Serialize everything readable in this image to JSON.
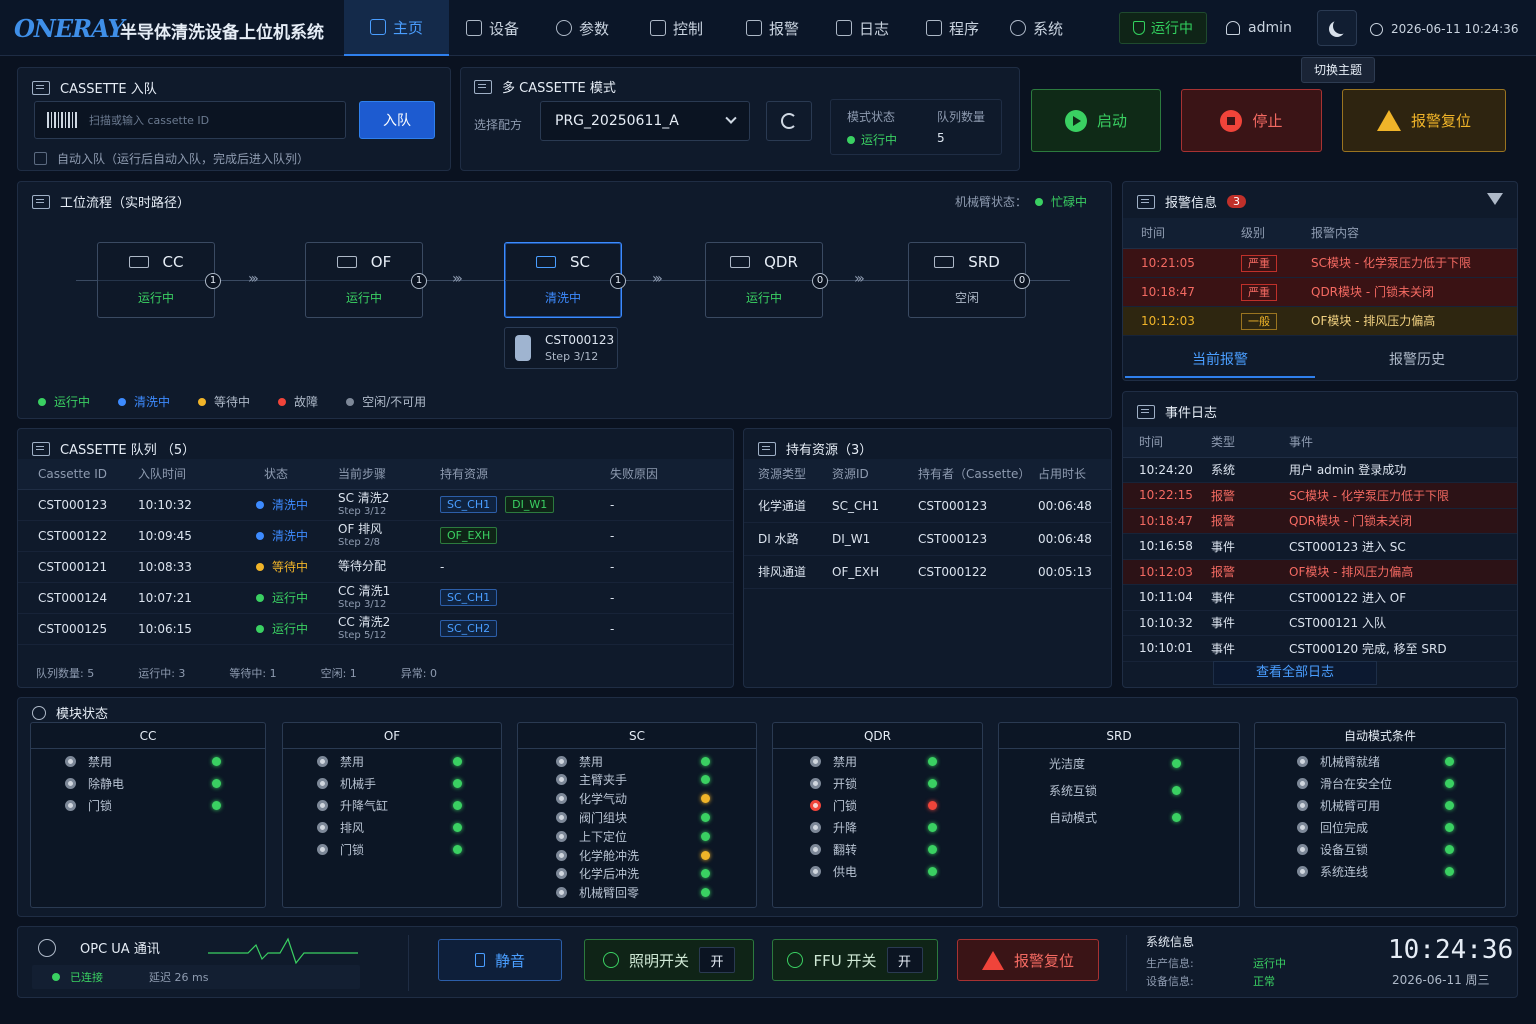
{
  "header": {
    "logo": "ONERAY",
    "title": "半导体清洗设备上位机系统",
    "nav": [
      {
        "label": "主页",
        "icon": "home-icon"
      },
      {
        "label": "设备",
        "icon": "device-icon"
      },
      {
        "label": "参数",
        "icon": "gear-icon"
      },
      {
        "label": "控制",
        "icon": "control-icon"
      },
      {
        "label": "报警",
        "icon": "warning-icon"
      },
      {
        "label": "日志",
        "icon": "log-icon"
      },
      {
        "label": "程序",
        "icon": "program-icon"
      },
      {
        "label": "系统",
        "icon": "system-icon"
      }
    ],
    "run_status": "运行中",
    "user": "admin",
    "theme_tooltip": "切换主题",
    "datetime": "2026-06-11  10:24:36"
  },
  "cassette_entry": {
    "title": "CASSETTE 入队",
    "placeholder": "扫描或输入 cassette ID",
    "enqueue": "入队",
    "auto_label": "自动入队（运行后自动入队，完成后进入队列）"
  },
  "multi": {
    "title": "多 CASSETTE 模式",
    "recipe_label": "选择配方",
    "recipe": "PRG_20250611_A",
    "mode_status_label": "模式状态",
    "mode_status": "运行中",
    "queue_count_label": "队列数量",
    "queue_count": "5",
    "start": "启动",
    "stop": "停止",
    "alarm_reset": "报警复位"
  },
  "flow": {
    "title": "工位流程（实时路径）",
    "arm_label": "机械臂状态：",
    "arm_status": "忙碌中",
    "nodes": [
      {
        "name": "CC",
        "status": "运行中",
        "count": "1"
      },
      {
        "name": "OF",
        "status": "运行中",
        "count": "1"
      },
      {
        "name": "SC",
        "status": "清洗中",
        "count": "1"
      },
      {
        "name": "QDR",
        "status": "运行中",
        "count": "0"
      },
      {
        "name": "SRD",
        "status": "空闲",
        "count": "0"
      }
    ],
    "sc_cassette": "CST000123",
    "sc_step": "Step 3/12",
    "legend": [
      "运行中",
      "清洗中",
      "等待中",
      "故障",
      "空闲/不可用"
    ]
  },
  "alarms": {
    "title": "报警信息",
    "count": "3",
    "headers": [
      "时间",
      "级别",
      "报警内容"
    ],
    "rows": [
      {
        "time": "10:21:05",
        "level": "严重",
        "content": "SC模块 - 化学泵压力低于下限"
      },
      {
        "time": "10:18:47",
        "level": "严重",
        "content": "QDR模块 - 门锁未关闭"
      },
      {
        "time": "10:12:03",
        "level": "一般",
        "content": "OF模块 - 排风压力偏高"
      }
    ],
    "tab_current": "当前报警",
    "tab_history": "报警历史"
  },
  "queue": {
    "title": "CASSETTE 队列 （5）",
    "headers": [
      "Cassette ID",
      "入队时间",
      "状态",
      "当前步骤",
      "持有资源",
      "失败原因"
    ],
    "rows": [
      {
        "id": "CST000123",
        "time": "10:10:32",
        "status": "清洗中",
        "step": "SC 清洗2",
        "step_sub": "Step 3/12",
        "res": [
          "SC_CH1",
          "DI_W1"
        ],
        "fail": "-"
      },
      {
        "id": "CST000122",
        "time": "10:09:45",
        "status": "清洗中",
        "step": "OF 排风",
        "step_sub": "Step 2/8",
        "res": [
          "OF_EXH"
        ],
        "fail": "-"
      },
      {
        "id": "CST000121",
        "time": "10:08:33",
        "status": "等待中",
        "step": "等待分配",
        "step_sub": "",
        "res": [],
        "res_text": "-",
        "fail": "-"
      },
      {
        "id": "CST000124",
        "time": "10:07:21",
        "status": "运行中",
        "step": "CC 清洗1",
        "step_sub": "Step 3/12",
        "res": [
          "SC_CH1"
        ],
        "fail": "-"
      },
      {
        "id": "CST000125",
        "time": "10:06:15",
        "status": "运行中",
        "step": "CC 清洗2",
        "step_sub": "Step 5/12",
        "res": [
          "SC_CH2"
        ],
        "fail": "-"
      }
    ],
    "footer": [
      "队列数量:  5",
      "运行中:  3",
      "等待中:  1",
      "空闲:  1",
      "异常:  0"
    ]
  },
  "resources": {
    "title": "持有资源（3）",
    "headers": [
      "资源类型",
      "资源ID",
      "持有者（Cassette）",
      "占用时长"
    ],
    "rows": [
      [
        "化学通道",
        "SC_CH1",
        "CST000123",
        "00:06:48"
      ],
      [
        "DI 水路",
        "DI_W1",
        "CST000123",
        "00:06:48"
      ],
      [
        "排风通道",
        "OF_EXH",
        "CST000122",
        "00:05:13"
      ]
    ]
  },
  "events": {
    "title": "事件日志",
    "headers": [
      "时间",
      "类型",
      "事件"
    ],
    "rows": [
      {
        "time": "10:24:20",
        "type": "系统",
        "event": "用户 admin 登录成功",
        "alarm": false
      },
      {
        "time": "10:22:15",
        "type": "报警",
        "event": "SC模块 - 化学泵压力低于下限",
        "alarm": true
      },
      {
        "time": "10:18:47",
        "type": "报警",
        "event": "QDR模块 - 门锁未关闭",
        "alarm": true
      },
      {
        "time": "10:16:58",
        "type": "事件",
        "event": "CST000123 进入 SC",
        "alarm": false
      },
      {
        "time": "10:12:03",
        "type": "报警",
        "event": "OF模块 - 排风压力偏高",
        "alarm": true
      },
      {
        "time": "10:11:04",
        "type": "事件",
        "event": "CST000122 进入 OF",
        "alarm": false
      },
      {
        "time": "10:10:32",
        "type": "事件",
        "event": "CST000121 入队",
        "alarm": false
      },
      {
        "time": "10:10:01",
        "type": "事件",
        "event": "CST000120 完成, 移至 SRD",
        "alarm": false
      }
    ],
    "view_all": "查看全部日志"
  },
  "modules": {
    "title": "模块状态",
    "groups": [
      {
        "name": "CC",
        "items": [
          [
            "禁用",
            "g"
          ],
          [
            "除静电",
            "g"
          ],
          [
            "门锁",
            "g"
          ]
        ]
      },
      {
        "name": "OF",
        "items": [
          [
            "禁用",
            "g"
          ],
          [
            "机械手",
            "g"
          ],
          [
            "升降气缸",
            "g"
          ],
          [
            "排风",
            "g"
          ],
          [
            "门锁",
            "g"
          ]
        ]
      },
      {
        "name": "SC",
        "items": [
          [
            "禁用",
            "g"
          ],
          [
            "主臂夹手",
            "g"
          ],
          [
            "化学气动",
            "y"
          ],
          [
            "阀门组块",
            "g"
          ],
          [
            "上下定位",
            "g"
          ],
          [
            "化学舱冲洗",
            "y"
          ],
          [
            "化学后冲洗",
            "g"
          ],
          [
            "机械臂回零",
            "g"
          ]
        ]
      },
      {
        "name": "QDR",
        "items": [
          [
            "禁用",
            "g"
          ],
          [
            "开锁",
            "g"
          ],
          [
            "门锁",
            "r"
          ],
          [
            "升降",
            "g"
          ],
          [
            "翻转",
            "g"
          ],
          [
            "供电",
            "g"
          ]
        ]
      },
      {
        "name": "SRD",
        "items": [
          [
            "光洁度",
            "g"
          ],
          [
            "系统互锁",
            "g"
          ],
          [
            "自动模式",
            "g"
          ]
        ]
      },
      {
        "name": "自动模式条件",
        "items": [
          [
            "机械臂就绪",
            "g"
          ],
          [
            "滑台在安全位",
            "g"
          ],
          [
            "机械臂可用",
            "g"
          ],
          [
            "回位完成",
            "g"
          ],
          [
            "设备互锁",
            "g"
          ],
          [
            "系统连线",
            "g"
          ]
        ]
      }
    ]
  },
  "footer": {
    "opc_title": "OPC UA 通讯",
    "opc_status": "已连接",
    "latency": "延迟  26 ms",
    "mute": "静音",
    "light": "照明开关",
    "light_state": "开",
    "ffu": "FFU 开关",
    "ffu_state": "开",
    "alarm_reset": "报警复位",
    "sysinfo_title": "系统信息",
    "prod_label": "生产信息:",
    "prod_value": "运行中",
    "dev_label": "设备信息:",
    "dev_value": "正常",
    "time": "10:24:36",
    "date": "2026-06-11  周三"
  },
  "colors": {
    "accent": "#2f80ed",
    "run": "#3ad062",
    "clean": "#3d8bff",
    "wait": "#f0b429",
    "fault": "#f0443a",
    "idle": "#7d8898"
  }
}
